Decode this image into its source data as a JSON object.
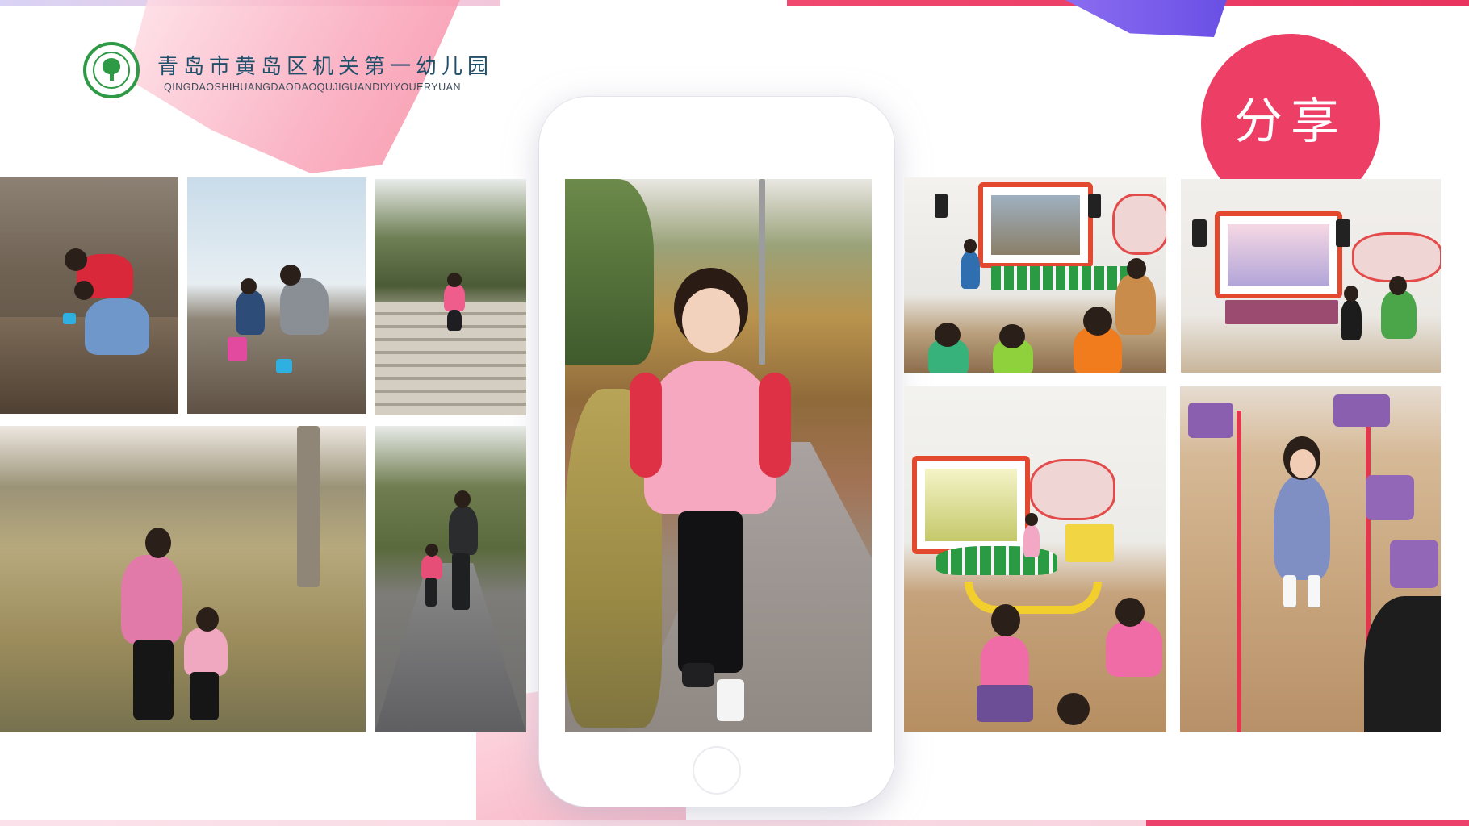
{
  "header": {
    "school_name": "青岛市黄岛区机关第一幼儿园",
    "school_pinyin": "QINGDAOSHIHUANGDAODAOQUJIGUANDIYIYOUERYUAN",
    "logo_icon": "school-tree-emblem-icon"
  },
  "badge": {
    "label": "分享"
  },
  "colors": {
    "accent": "#ed3e66",
    "logo_green": "#2e9a45",
    "title_blue": "#1f4f6b"
  },
  "photos": [
    {
      "name": "photo-beach-digging",
      "subject": "mother and child at rocky seashore"
    },
    {
      "name": "photo-beach-father",
      "subject": "father and child at beach"
    },
    {
      "name": "photo-park-steps",
      "subject": "child on park steps"
    },
    {
      "name": "photo-reeds-mother",
      "subject": "mother and daughter among reeds"
    },
    {
      "name": "photo-path-father",
      "subject": "father and child walking on path"
    },
    {
      "name": "photo-featured-girl",
      "subject": "girl walking on park path"
    },
    {
      "name": "photo-classroom-presentation",
      "subject": "child presenting at smart board"
    },
    {
      "name": "photo-classroom-teacher",
      "subject": "child with teacher at smart board"
    },
    {
      "name": "photo-classroom-circle",
      "subject": "children seated in classroom"
    },
    {
      "name": "photo-classroom-show",
      "subject": "girl showing object in classroom"
    }
  ]
}
